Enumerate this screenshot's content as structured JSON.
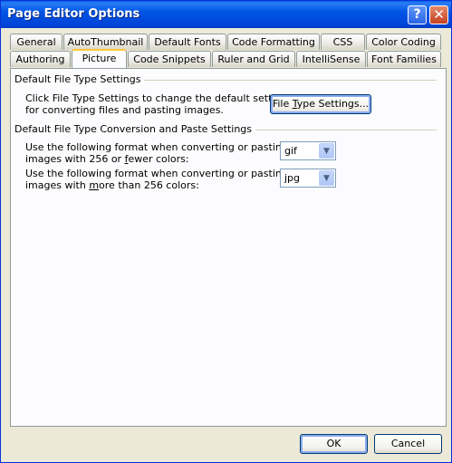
{
  "window": {
    "title": "Page Editor Options",
    "help_label": "?",
    "close_label": "✕"
  },
  "tabs_row1": [
    "General",
    "AutoThumbnail",
    "Default Fonts",
    "Code Formatting",
    "CSS",
    "Color Coding"
  ],
  "tabs_row2": [
    "Authoring",
    "Picture",
    "Code Snippets",
    "Ruler and Grid",
    "IntelliSense",
    "Font Families"
  ],
  "active_tab": "Picture",
  "section1": {
    "title": "Default File Type Settings",
    "line1": "Click File Type Settings to change the default settings",
    "line2": "for converting files and pasting images.",
    "button": {
      "pre": "File ",
      "u": "T",
      "post": "ype Settings..."
    }
  },
  "section2": {
    "title": "Default File Type Conversion and Paste Settings",
    "row1_line1": "Use the following format when converting or pasting",
    "row1_line2": {
      "pre": "images with 256 or ",
      "u": "f",
      "post": "ewer colors:"
    },
    "row1_value": "gif",
    "row2_line1": "Use the following format when converting or pasting",
    "row2_line2": {
      "pre": "images with ",
      "u": "m",
      "post": "ore than 256 colors:"
    },
    "row2_value": "jpg"
  },
  "footer": {
    "ok_label": "OK",
    "cancel_label": "Cancel"
  },
  "icons": {
    "dropdown": "chevron-down-icon"
  }
}
